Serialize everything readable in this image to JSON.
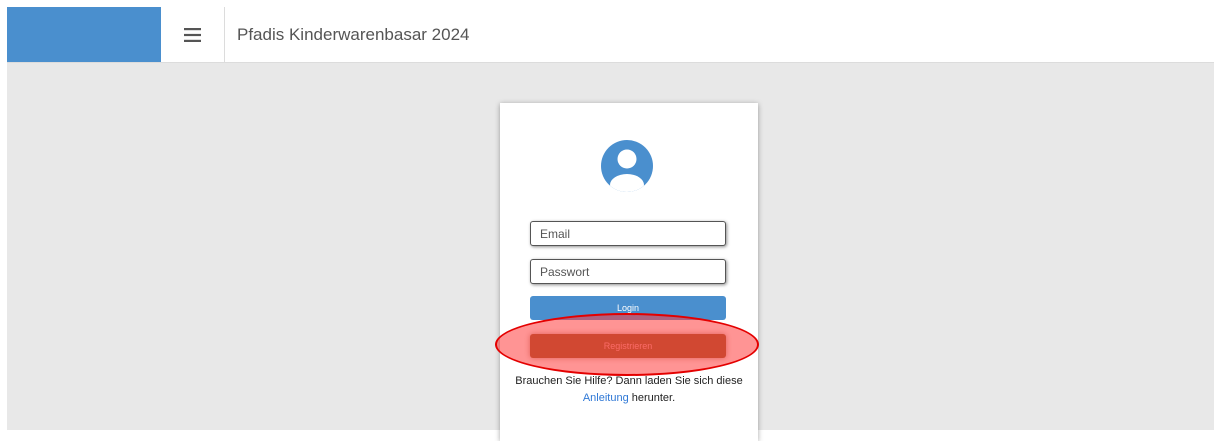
{
  "header": {
    "title": "Pfadis Kinderwarenbasar 2024",
    "brand_color": "#4a8fce",
    "menu_icon": "hamburger-menu-icon"
  },
  "login": {
    "avatar_icon": "user-avatar-icon",
    "email_placeholder": "Email",
    "password_placeholder": "Passwort",
    "login_label": "Login",
    "register_label": "Registrieren",
    "help_prefix": "Brauchen Sie Hilfe? Dann laden Sie sich diese",
    "help_link": "Anleitung",
    "help_suffix": " herunter."
  },
  "colors": {
    "login_button": "#4a8fce",
    "register_button": "#9a5726",
    "highlight": "#e40000",
    "background": "#e8e8e8"
  }
}
